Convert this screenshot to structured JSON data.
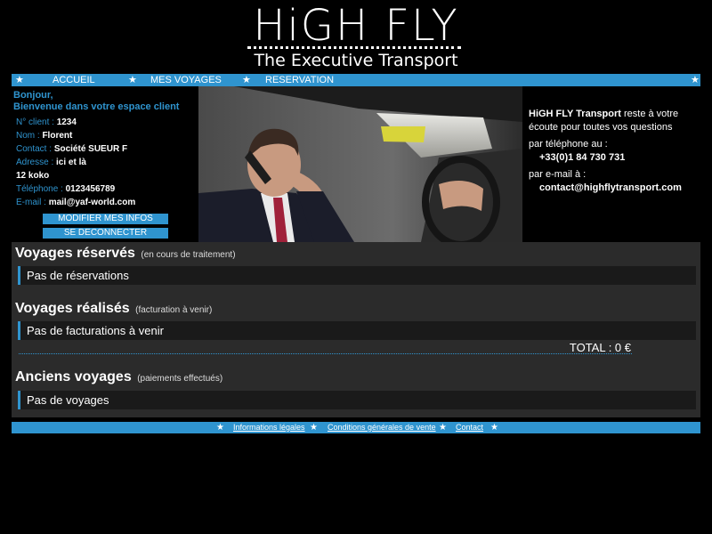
{
  "header": {
    "logo_main": "HiGH FLY",
    "logo_sub": "The Executive Transport"
  },
  "nav": {
    "items": [
      {
        "label": "ACCUEIL"
      },
      {
        "label": "MES VOYAGES"
      },
      {
        "label": "RESERVATION"
      }
    ],
    "star": "★"
  },
  "client": {
    "greeting_line1": "Bonjour,",
    "greeting_line2": "Bienvenue dans votre espace client",
    "fields": [
      {
        "label": "N° client :",
        "value": "1234"
      },
      {
        "label": "Nom :",
        "value": "Florent"
      },
      {
        "label": "Contact :",
        "value": "Société SUEUR F"
      },
      {
        "label": "Adresse :",
        "value": "ici et là"
      },
      {
        "label": "",
        "value": "12 koko"
      },
      {
        "label": "Téléphone :",
        "value": "0123456789"
      },
      {
        "label": "E-mail :",
        "value": "mail@yaf-world.com"
      }
    ],
    "edit_button": "MODIFIER MES INFOS",
    "logout_button": "SE DECONNECTER"
  },
  "contact": {
    "brand": "HiGH FLY Transport",
    "line1_rest": " reste à votre",
    "line2": "écoute pour toutes vos questions",
    "phone_label": "par téléphone au :",
    "phone": "+33(0)1 84 730 731",
    "email_label": "par e-mail à :",
    "email": "contact@highflytransport.com"
  },
  "sections": {
    "reserved": {
      "title": "Voyages réservés",
      "note": "(en cours de traitement)",
      "empty": "Pas de réservations"
    },
    "done": {
      "title": "Voyages réalisés",
      "note": "(facturation à venir)",
      "empty": "Pas de facturations à venir",
      "total": "TOTAL : 0 €"
    },
    "old": {
      "title": "Anciens voyages",
      "note": "(paiements effectués)",
      "empty": "Pas de voyages"
    }
  },
  "footer": {
    "links": [
      {
        "label": "Informations légales"
      },
      {
        "label": "Conditions générales de vente"
      },
      {
        "label": "Contact"
      }
    ]
  },
  "colors": {
    "accent": "#2f94cf",
    "background": "#000000",
    "panel": "#2b2b2b"
  }
}
